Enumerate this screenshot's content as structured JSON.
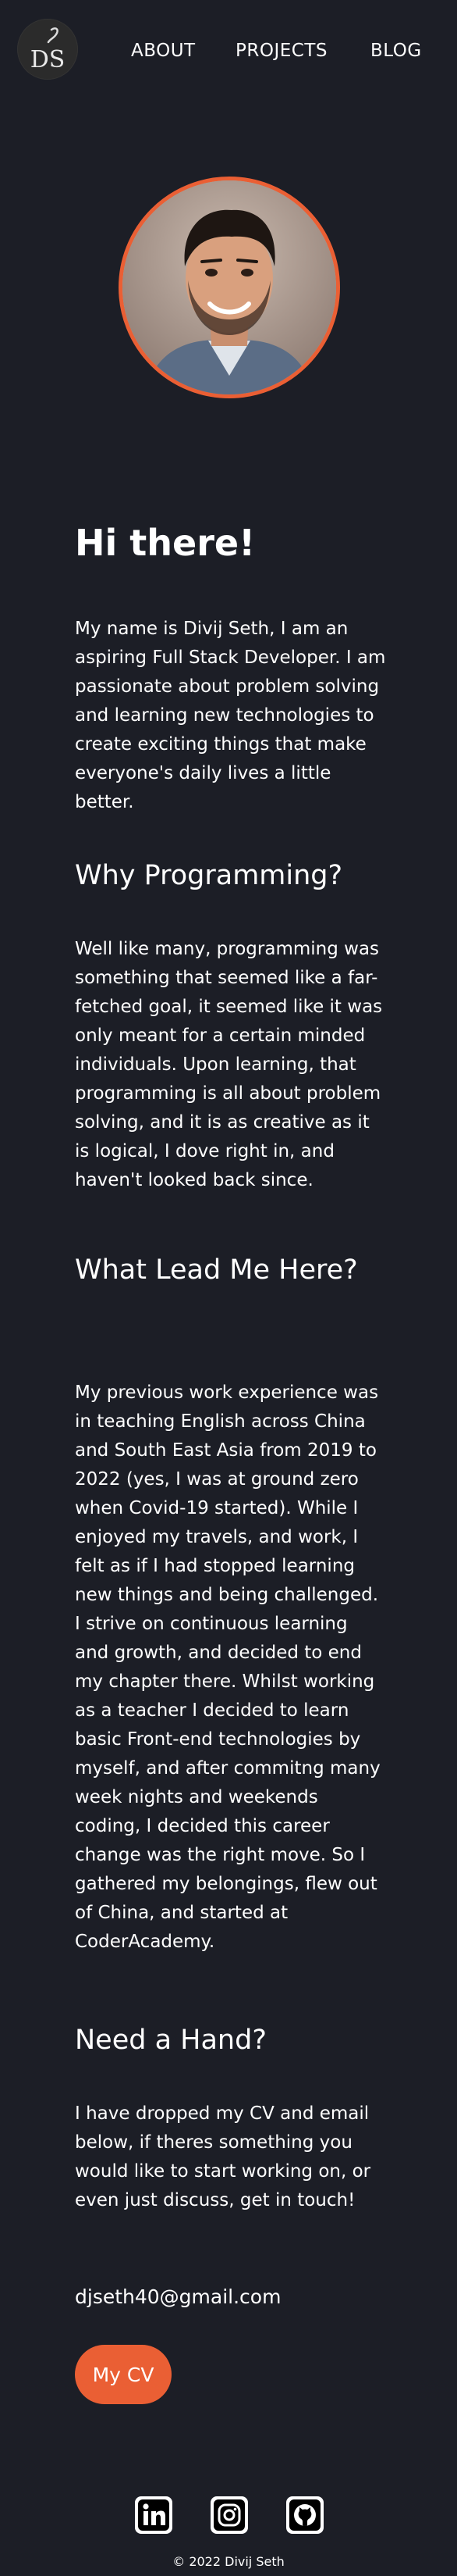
{
  "nav": {
    "logo_text": "DS",
    "about": "ABOUT",
    "projects": "PROJECTS",
    "blog": "BLOG"
  },
  "intro": {
    "heading": "Hi there!",
    "text": "My name is Divij Seth, I am an aspiring Full Stack Developer. I am passionate about problem solving and learning new technologies to create exciting things that make everyone's daily lives a little better."
  },
  "why": {
    "heading": "Why Programming?",
    "text": "Well like many, programming was something that seemed like a far-fetched goal, it seemed like it was only meant for a certain minded individuals. Upon learning, that programming is all about problem solving, and it is as creative as it is logical, I dove right in, and haven't looked back since."
  },
  "lead": {
    "heading": "What Lead Me Here?",
    "text": "My previous work experience was in teaching English across China and South East Asia from 2019 to 2022 (yes, I was at ground zero when Covid-19 started). While I enjoyed my travels, and work, I felt as if I had stopped learning new things and being challenged. I strive on continuous learning and growth, and decided to end my chapter there. Whilst working as a teacher I decided to learn basic Front-end technologies by myself, and after commitng many week nights and weekends coding, I decided this career change was the right move. So I gathered my belongings, flew out of China, and started at CoderAcademy."
  },
  "hand": {
    "heading": "Need a Hand?",
    "text": "I have dropped my CV and email below, if theres something you would like to start working on, or even just discuss, get in touch!",
    "email": "djseth40@gmail.com",
    "cv_label": "My CV"
  },
  "social": {
    "icons": [
      "linkedin-icon",
      "instagram-icon",
      "github-icon"
    ]
  },
  "footer": {
    "copyright": "© 2022 Divij Seth"
  },
  "colors": {
    "background": "#1c1e26",
    "accent": "#ea5f34",
    "text": "#ffffff"
  }
}
